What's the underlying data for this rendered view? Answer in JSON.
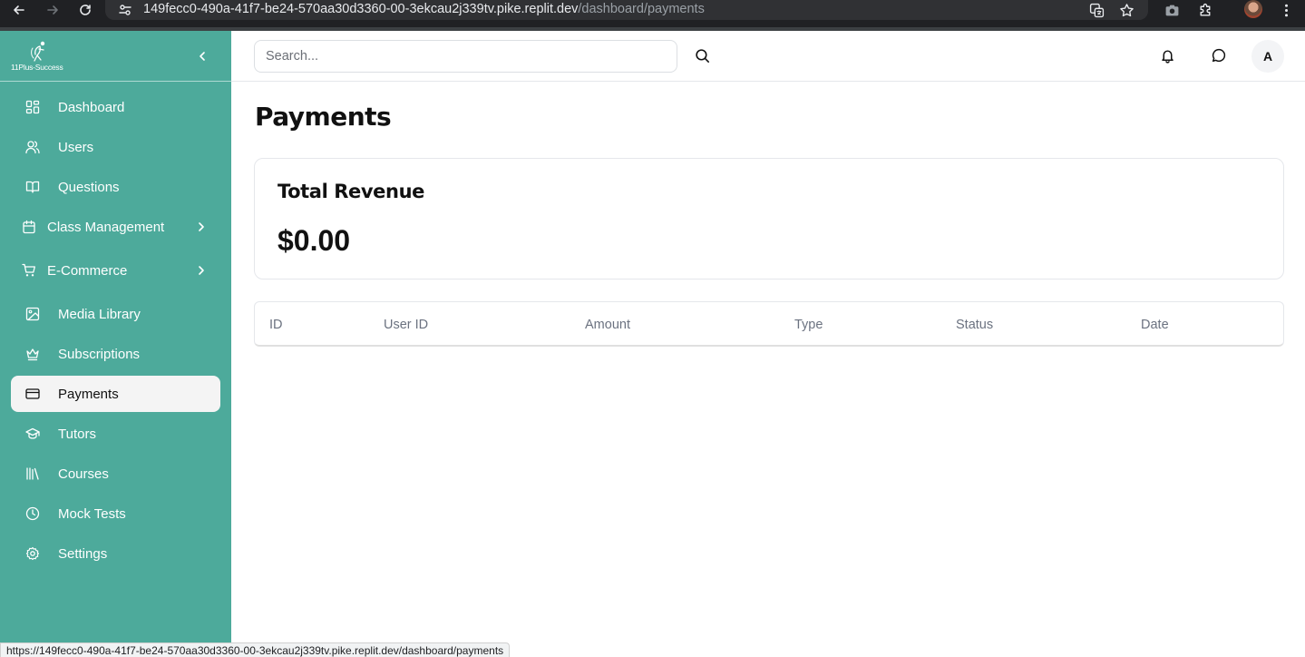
{
  "browser": {
    "url_host": "149fecc0-490a-41f7-be24-570aa30d3360-00-3ekcau2j339tv.pike.replit.dev",
    "url_path": "/dashboard/payments",
    "status_url": "https://149fecc0-490a-41f7-be24-570aa30d3360-00-3ekcau2j339tv.pike.replit.dev/dashboard/payments"
  },
  "sidebar": {
    "logo_text": "11Plus-Success",
    "bg_color": "#4daa9b",
    "items": [
      {
        "label": "Dashboard",
        "icon": "dashboard-grid-icon"
      },
      {
        "label": "Users",
        "icon": "users-icon"
      },
      {
        "label": "Questions",
        "icon": "book-open-icon"
      },
      {
        "label": "Class Management",
        "icon": "calendar-icon",
        "expandable": true
      },
      {
        "label": "E-Commerce",
        "icon": "shopping-cart-icon",
        "expandable": true
      },
      {
        "label": "Media Library",
        "icon": "image-icon"
      },
      {
        "label": "Subscriptions",
        "icon": "crown-icon"
      },
      {
        "label": "Payments",
        "icon": "credit-card-icon",
        "active": true
      },
      {
        "label": "Tutors",
        "icon": "graduation-cap-icon"
      },
      {
        "label": "Courses",
        "icon": "library-icon"
      },
      {
        "label": "Mock Tests",
        "icon": "clock-icon"
      },
      {
        "label": "Settings",
        "icon": "settings-gear-icon"
      }
    ]
  },
  "topbar": {
    "search_placeholder": "Search...",
    "avatar_initial": "A"
  },
  "main": {
    "page_title": "Payments",
    "revenue_card": {
      "title": "Total Revenue",
      "value": "$0.00"
    },
    "table": {
      "columns": [
        "ID",
        "User ID",
        "Amount",
        "Type",
        "Status",
        "Date"
      ],
      "rows": []
    }
  }
}
